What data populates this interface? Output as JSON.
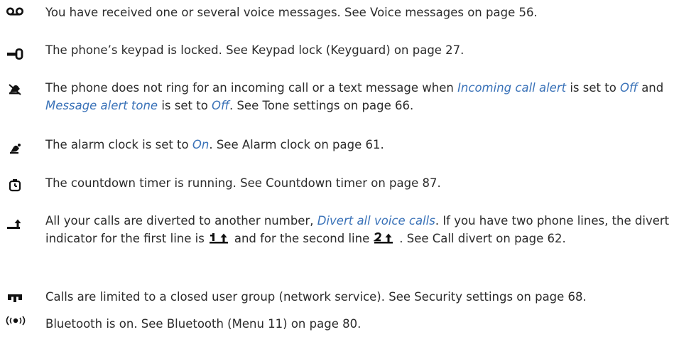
{
  "rows": [
    {
      "icon": "voicemail-icon",
      "text": "You have received one or several voice messages. See Voice messages on page 56."
    },
    {
      "icon": "key-lock-icon",
      "text": "The phone’s keypad is locked. See Keypad lock (Keyguard) on page 27."
    },
    {
      "icon": "silent-icon",
      "t1": "The phone does not ring for an incoming call or a text message when ",
      "r1": "Incoming call alert",
      "t2": " is set to ",
      "r2": "Off",
      "t3": " and ",
      "r3": "Message alert tone",
      "t4": " is set to ",
      "r4": "Off",
      "t5": ". See Tone settings on page 66."
    },
    {
      "icon": "alarm-clock-icon",
      "t1": "The alarm clock is set to ",
      "r1": "On",
      "t2": ". See Alarm clock on page 61."
    },
    {
      "icon": "countdown-timer-icon",
      "text": "The countdown timer is running. See Countdown timer on page 87."
    },
    {
      "icon": "call-divert-icon",
      "t1": "All your calls are diverted to another number, ",
      "r1": "Divert all voice calls",
      "t2": ". If you have two phone lines, the divert indicator for the first line is",
      "t3": "and for the second line",
      "t4": ". See Call divert on page 62."
    },
    {
      "icon": "closed-user-group-icon",
      "text": "Calls are limited to a closed user group (network service). See Security settings on page 68."
    },
    {
      "icon": "bluetooth-icon",
      "text": "Bluetooth is on. See Bluetooth (Menu 11) on page 80."
    }
  ],
  "colors": {
    "text": "#2b2b2b",
    "reference": "#3a72b8",
    "icon": "#111111"
  }
}
